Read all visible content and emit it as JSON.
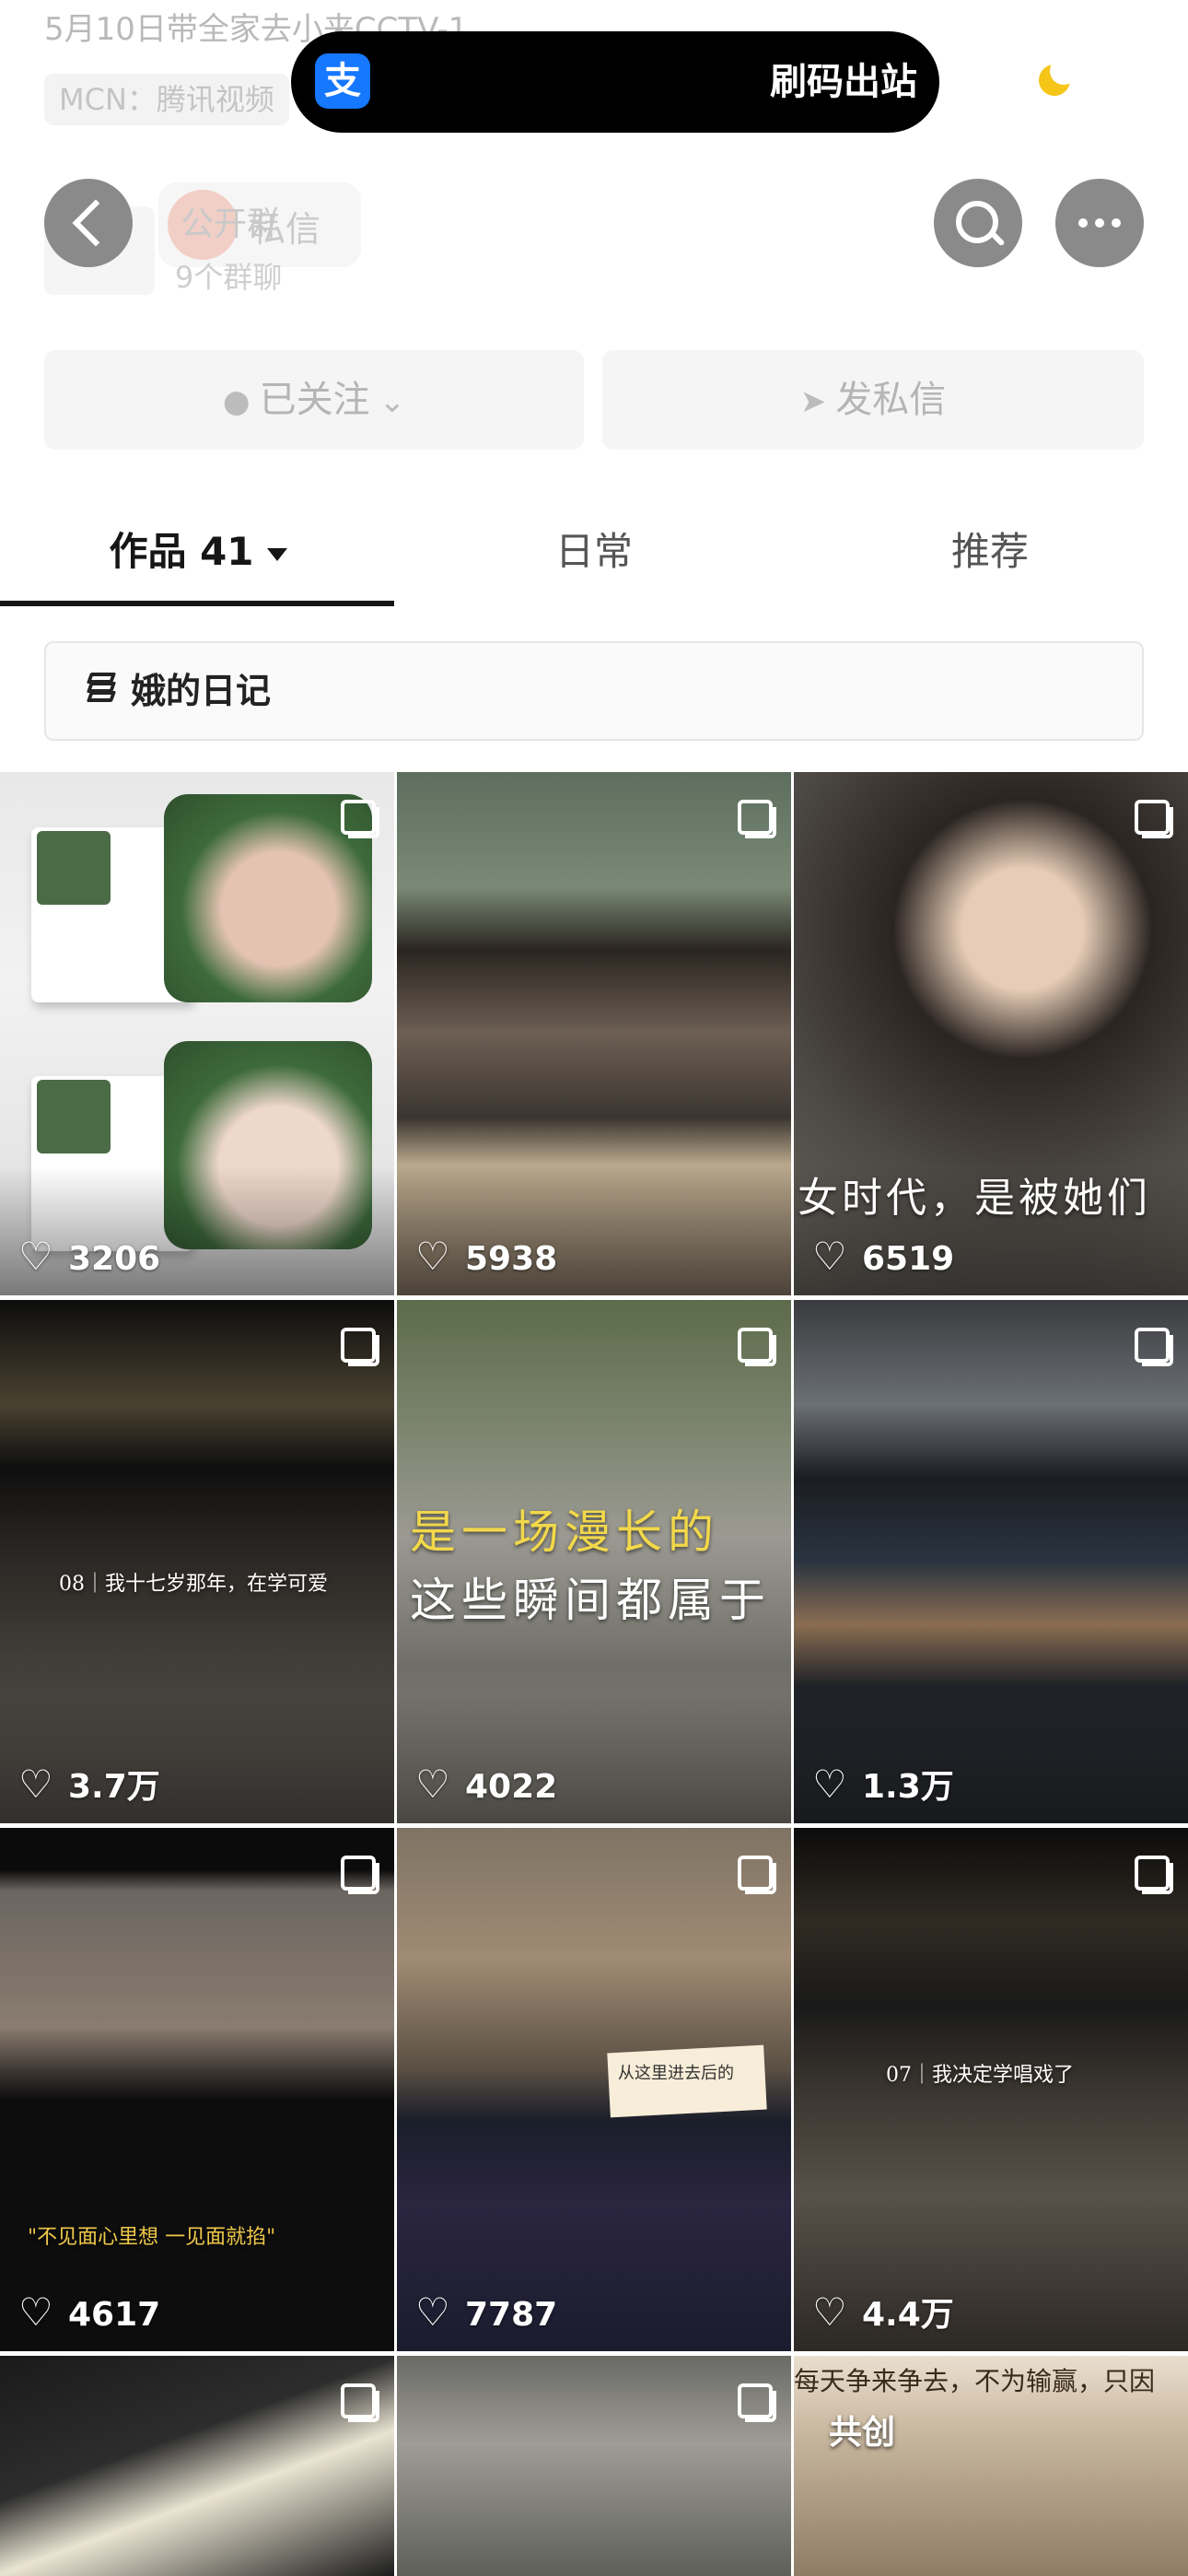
{
  "status": {
    "title": "5月10日带全家去小来CCTV-1",
    "mcn": "MCN：腾讯视频",
    "pill_app_icon": "支",
    "pill_label": "刷码出站"
  },
  "header": {
    "group_title": "公开群",
    "group_msg": "私信",
    "group_sub": "9个群聊",
    "follow_label": "已关注",
    "dm_label": "发私信"
  },
  "tabs": [
    {
      "label": "作品 41"
    },
    {
      "label": "日常"
    },
    {
      "label": "推荐"
    }
  ],
  "collection": {
    "label": "娥的日记"
  },
  "grid": [
    {
      "likes": "3206"
    },
    {
      "likes": "5938"
    },
    {
      "likes": "6519",
      "overlay": "女时代，是被她们"
    },
    {
      "likes": "3.7万",
      "overlay": "08｜我十七岁那年，在学可爱"
    },
    {
      "likes": "4022",
      "overlay": "是一场漫长的",
      "overlay2": "这些瞬间都属于"
    },
    {
      "likes": "1.3万"
    },
    {
      "likes": "4617",
      "overlay": "\"不见面心里想 一见面就掐\""
    },
    {
      "likes": "7787",
      "overlay": "从这里进去后的"
    },
    {
      "likes": "4.4万",
      "overlay": "07｜我决定学唱戏了"
    },
    {
      "overlay": ""
    },
    {
      "overlay": ""
    },
    {
      "overlay": "每天争来争去，不为输赢，只因",
      "badge": "共创"
    }
  ],
  "colors": {
    "accent": "#161616",
    "alipay_blue": "#1677ff",
    "pill_bg": "#000000",
    "like_text": "#ffffff"
  }
}
